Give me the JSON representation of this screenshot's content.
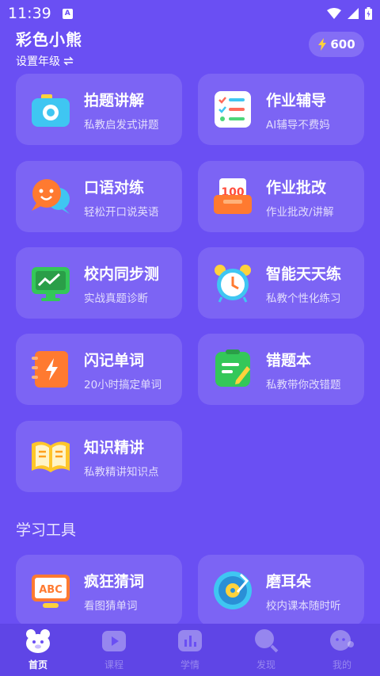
{
  "status_bar": {
    "time": "11:39",
    "notification_icon": "a-letter-icon",
    "icons": [
      "wifi-icon",
      "signal-icon",
      "battery-icon"
    ]
  },
  "header": {
    "title": "彩色小熊",
    "grade_label": "设置年级",
    "grade_icon": "swap-arrows-icon",
    "points": "600",
    "points_icon": "lightning-icon"
  },
  "features": [
    {
      "name": "拍题讲解",
      "desc": "私教启发式讲题",
      "icon": "camera-icon"
    },
    {
      "name": "作业辅导",
      "desc": "AI辅导不费妈",
      "icon": "checklist-icon"
    },
    {
      "name": "口语对练",
      "desc": "轻松开口说英语",
      "icon": "speech-bubbles-icon"
    },
    {
      "name": "作业批改",
      "desc": "作业批改/讲解",
      "icon": "score-100-icon"
    },
    {
      "name": "校内同步测",
      "desc": "实战真题诊断",
      "icon": "trend-screen-icon"
    },
    {
      "name": "智能天天练",
      "desc": "私教个性化练习",
      "icon": "alarm-clock-icon"
    },
    {
      "name": "闪记单词",
      "desc": "20小时搞定单词",
      "icon": "flash-book-icon"
    },
    {
      "name": "错题本",
      "desc": "私教带你改错题",
      "icon": "notebook-pencil-icon"
    },
    {
      "name": "知识精讲",
      "desc": "私教精讲知识点",
      "icon": "open-book-icon"
    }
  ],
  "tools_section": {
    "title": "学习工具",
    "items": [
      {
        "name": "疯狂猜词",
        "desc": "看图猜单词",
        "icon": "abc-board-icon",
        "board_text": "ABC"
      },
      {
        "name": "磨耳朵",
        "desc": "校内课本随时听",
        "icon": "vinyl-record-icon"
      }
    ]
  },
  "tabs": [
    {
      "label": "首页",
      "icon": "bear-home-icon",
      "active": true
    },
    {
      "label": "课程",
      "icon": "play-course-icon",
      "active": false
    },
    {
      "label": "学情",
      "icon": "bar-stats-icon",
      "active": false
    },
    {
      "label": "发现",
      "icon": "magnifier-icon",
      "active": false
    },
    {
      "label": "我的",
      "icon": "bear-profile-icon",
      "active": false
    }
  ]
}
